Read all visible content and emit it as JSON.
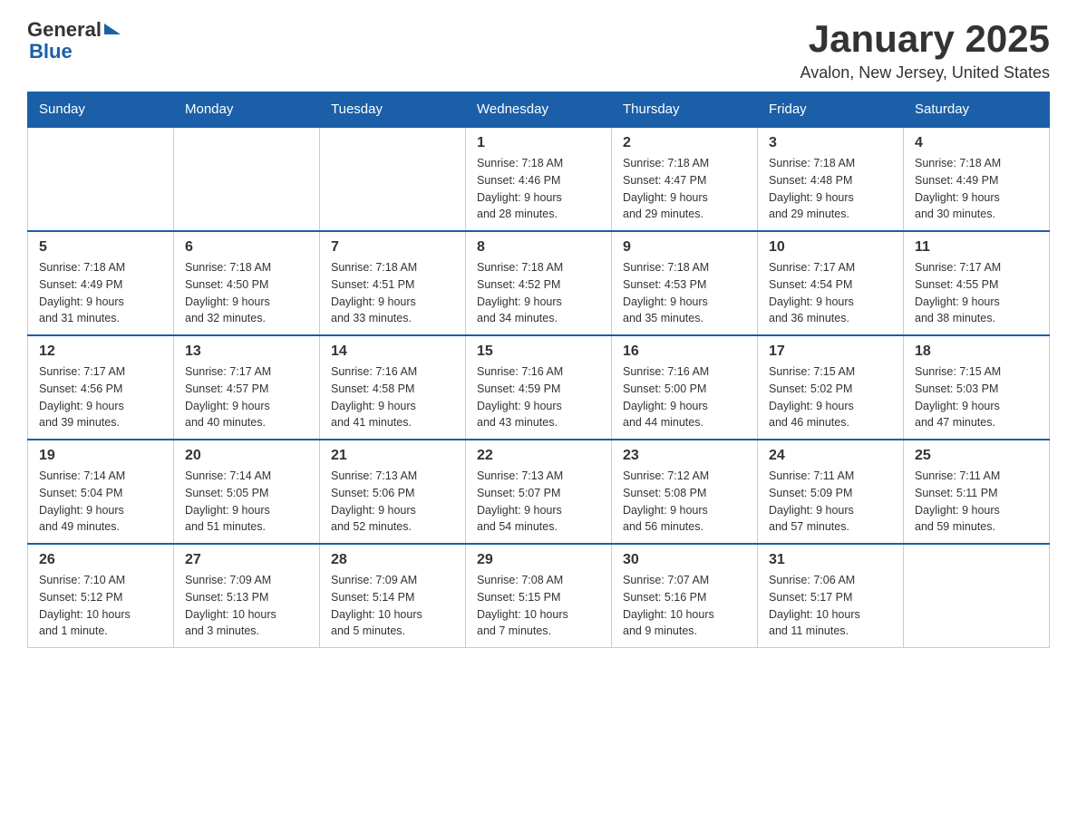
{
  "header": {
    "title": "January 2025",
    "subtitle": "Avalon, New Jersey, United States",
    "logo_general": "General",
    "logo_blue": "Blue"
  },
  "calendar": {
    "days_of_week": [
      "Sunday",
      "Monday",
      "Tuesday",
      "Wednesday",
      "Thursday",
      "Friday",
      "Saturday"
    ],
    "weeks": [
      [
        {
          "day": "",
          "info": ""
        },
        {
          "day": "",
          "info": ""
        },
        {
          "day": "",
          "info": ""
        },
        {
          "day": "1",
          "info": "Sunrise: 7:18 AM\nSunset: 4:46 PM\nDaylight: 9 hours\nand 28 minutes."
        },
        {
          "day": "2",
          "info": "Sunrise: 7:18 AM\nSunset: 4:47 PM\nDaylight: 9 hours\nand 29 minutes."
        },
        {
          "day": "3",
          "info": "Sunrise: 7:18 AM\nSunset: 4:48 PM\nDaylight: 9 hours\nand 29 minutes."
        },
        {
          "day": "4",
          "info": "Sunrise: 7:18 AM\nSunset: 4:49 PM\nDaylight: 9 hours\nand 30 minutes."
        }
      ],
      [
        {
          "day": "5",
          "info": "Sunrise: 7:18 AM\nSunset: 4:49 PM\nDaylight: 9 hours\nand 31 minutes."
        },
        {
          "day": "6",
          "info": "Sunrise: 7:18 AM\nSunset: 4:50 PM\nDaylight: 9 hours\nand 32 minutes."
        },
        {
          "day": "7",
          "info": "Sunrise: 7:18 AM\nSunset: 4:51 PM\nDaylight: 9 hours\nand 33 minutes."
        },
        {
          "day": "8",
          "info": "Sunrise: 7:18 AM\nSunset: 4:52 PM\nDaylight: 9 hours\nand 34 minutes."
        },
        {
          "day": "9",
          "info": "Sunrise: 7:18 AM\nSunset: 4:53 PM\nDaylight: 9 hours\nand 35 minutes."
        },
        {
          "day": "10",
          "info": "Sunrise: 7:17 AM\nSunset: 4:54 PM\nDaylight: 9 hours\nand 36 minutes."
        },
        {
          "day": "11",
          "info": "Sunrise: 7:17 AM\nSunset: 4:55 PM\nDaylight: 9 hours\nand 38 minutes."
        }
      ],
      [
        {
          "day": "12",
          "info": "Sunrise: 7:17 AM\nSunset: 4:56 PM\nDaylight: 9 hours\nand 39 minutes."
        },
        {
          "day": "13",
          "info": "Sunrise: 7:17 AM\nSunset: 4:57 PM\nDaylight: 9 hours\nand 40 minutes."
        },
        {
          "day": "14",
          "info": "Sunrise: 7:16 AM\nSunset: 4:58 PM\nDaylight: 9 hours\nand 41 minutes."
        },
        {
          "day": "15",
          "info": "Sunrise: 7:16 AM\nSunset: 4:59 PM\nDaylight: 9 hours\nand 43 minutes."
        },
        {
          "day": "16",
          "info": "Sunrise: 7:16 AM\nSunset: 5:00 PM\nDaylight: 9 hours\nand 44 minutes."
        },
        {
          "day": "17",
          "info": "Sunrise: 7:15 AM\nSunset: 5:02 PM\nDaylight: 9 hours\nand 46 minutes."
        },
        {
          "day": "18",
          "info": "Sunrise: 7:15 AM\nSunset: 5:03 PM\nDaylight: 9 hours\nand 47 minutes."
        }
      ],
      [
        {
          "day": "19",
          "info": "Sunrise: 7:14 AM\nSunset: 5:04 PM\nDaylight: 9 hours\nand 49 minutes."
        },
        {
          "day": "20",
          "info": "Sunrise: 7:14 AM\nSunset: 5:05 PM\nDaylight: 9 hours\nand 51 minutes."
        },
        {
          "day": "21",
          "info": "Sunrise: 7:13 AM\nSunset: 5:06 PM\nDaylight: 9 hours\nand 52 minutes."
        },
        {
          "day": "22",
          "info": "Sunrise: 7:13 AM\nSunset: 5:07 PM\nDaylight: 9 hours\nand 54 minutes."
        },
        {
          "day": "23",
          "info": "Sunrise: 7:12 AM\nSunset: 5:08 PM\nDaylight: 9 hours\nand 56 minutes."
        },
        {
          "day": "24",
          "info": "Sunrise: 7:11 AM\nSunset: 5:09 PM\nDaylight: 9 hours\nand 57 minutes."
        },
        {
          "day": "25",
          "info": "Sunrise: 7:11 AM\nSunset: 5:11 PM\nDaylight: 9 hours\nand 59 minutes."
        }
      ],
      [
        {
          "day": "26",
          "info": "Sunrise: 7:10 AM\nSunset: 5:12 PM\nDaylight: 10 hours\nand 1 minute."
        },
        {
          "day": "27",
          "info": "Sunrise: 7:09 AM\nSunset: 5:13 PM\nDaylight: 10 hours\nand 3 minutes."
        },
        {
          "day": "28",
          "info": "Sunrise: 7:09 AM\nSunset: 5:14 PM\nDaylight: 10 hours\nand 5 minutes."
        },
        {
          "day": "29",
          "info": "Sunrise: 7:08 AM\nSunset: 5:15 PM\nDaylight: 10 hours\nand 7 minutes."
        },
        {
          "day": "30",
          "info": "Sunrise: 7:07 AM\nSunset: 5:16 PM\nDaylight: 10 hours\nand 9 minutes."
        },
        {
          "day": "31",
          "info": "Sunrise: 7:06 AM\nSunset: 5:17 PM\nDaylight: 10 hours\nand 11 minutes."
        },
        {
          "day": "",
          "info": ""
        }
      ]
    ]
  }
}
